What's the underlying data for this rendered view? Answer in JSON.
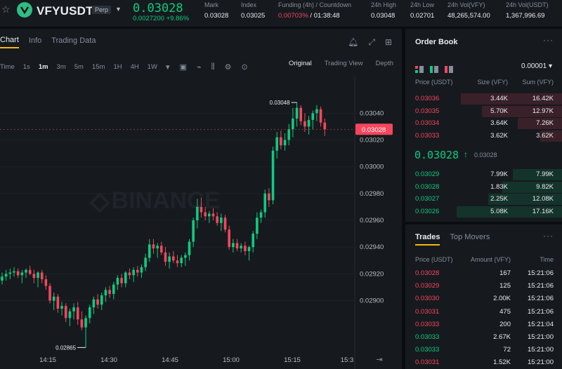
{
  "header": {
    "symbol": "VFYUSDT",
    "badge": "Perp",
    "last_price": "0.03028",
    "change": "0.0027200 +9.86%",
    "stats": [
      {
        "label": "Mark",
        "value": "0.03028"
      },
      {
        "label": "Index",
        "value": "0.03025"
      },
      {
        "label": "Funding (4h) / Countdown",
        "value_red": "0.00703%",
        "value": " / 01:38:48"
      },
      {
        "label": "24h High",
        "value": "0.03048"
      },
      {
        "label": "24h Low",
        "value": "0.02701"
      },
      {
        "label": "24h Vol(VFY)",
        "value": "48,265,574.00"
      },
      {
        "label": "24h Vol(USDT)",
        "value": "1,367,996.69"
      }
    ]
  },
  "chart_tabs": [
    "Chart",
    "Info",
    "Trading Data"
  ],
  "toolbar": {
    "time_label": "Time",
    "timeframes": [
      "1s",
      "1m",
      "3m",
      "5m",
      "15m",
      "1H",
      "4H",
      "1W"
    ],
    "active_timeframe": "1m",
    "views": [
      "Original",
      "Trading View",
      "Depth"
    ],
    "active_view": "Original"
  },
  "colors": {
    "up": "#0ecb81",
    "down": "#f6465d",
    "accent": "#f0b90b",
    "bg": "#0b0e11",
    "panel": "#161a1e"
  },
  "chart_data": {
    "type": "candlestick",
    "watermark": "BINANCE",
    "y_ticks": [
      "0.03040",
      "0.03020",
      "0.03000",
      "0.02980",
      "0.02960",
      "0.02940",
      "0.02920",
      "0.02900"
    ],
    "x_ticks": [
      "14:15",
      "14:30",
      "14:45",
      "15:00",
      "15:15",
      "15:3"
    ],
    "ylim": [
      0.02872,
      0.03058
    ],
    "high_label": "0.03048",
    "low_label": "0.02865",
    "current_price_tag": "0.03028",
    "candles": [
      [
        0.02915,
        0.02921,
        0.02912,
        0.02918
      ],
      [
        0.02918,
        0.02923,
        0.02915,
        0.0292
      ],
      [
        0.0292,
        0.02924,
        0.02916,
        0.02921
      ],
      [
        0.02921,
        0.02925,
        0.02918,
        0.02922
      ],
      [
        0.02922,
        0.02924,
        0.02917,
        0.02919
      ],
      [
        0.02919,
        0.02923,
        0.02913,
        0.02921
      ],
      [
        0.02921,
        0.02924,
        0.02917,
        0.02923
      ],
      [
        0.02923,
        0.02926,
        0.02919,
        0.0292
      ],
      [
        0.0292,
        0.02923,
        0.02913,
        0.02917
      ],
      [
        0.02917,
        0.02922,
        0.0291,
        0.02921
      ],
      [
        0.02921,
        0.02923,
        0.02913,
        0.02916
      ],
      [
        0.02916,
        0.02919,
        0.02908,
        0.02911
      ],
      [
        0.02911,
        0.02913,
        0.02898,
        0.029
      ],
      [
        0.029,
        0.02906,
        0.02893,
        0.02903
      ],
      [
        0.02903,
        0.02905,
        0.02891,
        0.02894
      ],
      [
        0.02894,
        0.02899,
        0.02889,
        0.02896
      ],
      [
        0.02896,
        0.02898,
        0.02884,
        0.02887
      ],
      [
        0.02887,
        0.02894,
        0.02881,
        0.02892
      ],
      [
        0.02892,
        0.02898,
        0.02886,
        0.02895
      ],
      [
        0.02895,
        0.02899,
        0.02882,
        0.02886
      ],
      [
        0.02886,
        0.02892,
        0.02878,
        0.0288
      ],
      [
        0.0288,
        0.02889,
        0.02865,
        0.02887
      ],
      [
        0.02887,
        0.02897,
        0.02883,
        0.02895
      ],
      [
        0.02895,
        0.02903,
        0.0289,
        0.02901
      ],
      [
        0.02901,
        0.02905,
        0.02894,
        0.02897
      ],
      [
        0.02897,
        0.02906,
        0.02893,
        0.02904
      ],
      [
        0.02904,
        0.0291,
        0.02899,
        0.02908
      ],
      [
        0.02908,
        0.02911,
        0.02902,
        0.02905
      ],
      [
        0.02905,
        0.02914,
        0.02901,
        0.02912
      ],
      [
        0.02912,
        0.02919,
        0.02908,
        0.02917
      ],
      [
        0.02917,
        0.0292,
        0.0291,
        0.02913
      ],
      [
        0.02913,
        0.02922,
        0.0291,
        0.02921
      ],
      [
        0.02921,
        0.02924,
        0.02916,
        0.02919
      ],
      [
        0.02919,
        0.02925,
        0.02914,
        0.02923
      ],
      [
        0.02923,
        0.02926,
        0.02918,
        0.02921
      ],
      [
        0.02921,
        0.02927,
        0.02917,
        0.02925
      ],
      [
        0.02925,
        0.02935,
        0.02922,
        0.02932
      ],
      [
        0.02932,
        0.02946,
        0.02929,
        0.02942
      ],
      [
        0.02942,
        0.02946,
        0.02935,
        0.02939
      ],
      [
        0.02939,
        0.02943,
        0.02932,
        0.02941
      ],
      [
        0.02941,
        0.02944,
        0.02934,
        0.02936
      ],
      [
        0.02936,
        0.0294,
        0.02926,
        0.02929
      ],
      [
        0.02929,
        0.02936,
        0.02924,
        0.02933
      ],
      [
        0.02933,
        0.02937,
        0.02928,
        0.0293
      ],
      [
        0.0293,
        0.02934,
        0.02925,
        0.02928
      ],
      [
        0.02928,
        0.02934,
        0.02925,
        0.02932
      ],
      [
        0.02932,
        0.02936,
        0.02926,
        0.02934
      ],
      [
        0.02934,
        0.02946,
        0.0293,
        0.02944
      ],
      [
        0.02944,
        0.02962,
        0.0294,
        0.0296
      ],
      [
        0.0296,
        0.02976,
        0.02954,
        0.0297
      ],
      [
        0.0297,
        0.02977,
        0.02962,
        0.02966
      ],
      [
        0.02966,
        0.0297,
        0.0296,
        0.02963
      ],
      [
        0.02963,
        0.02967,
        0.02958,
        0.02965
      ],
      [
        0.02965,
        0.02969,
        0.0296,
        0.02963
      ],
      [
        0.02963,
        0.02966,
        0.02956,
        0.02958
      ],
      [
        0.02958,
        0.02965,
        0.02952,
        0.02962
      ],
      [
        0.02962,
        0.02964,
        0.02951,
        0.02953
      ],
      [
        0.02953,
        0.02956,
        0.02938,
        0.0294
      ],
      [
        0.0294,
        0.02946,
        0.02936,
        0.02943
      ],
      [
        0.02943,
        0.02946,
        0.02937,
        0.02939
      ],
      [
        0.02939,
        0.02943,
        0.02936,
        0.02941
      ],
      [
        0.02941,
        0.02944,
        0.02934,
        0.02937
      ],
      [
        0.02937,
        0.02941,
        0.0293,
        0.0294
      ],
      [
        0.0294,
        0.02952,
        0.02936,
        0.0295
      ],
      [
        0.0295,
        0.02966,
        0.02946,
        0.02962
      ],
      [
        0.02962,
        0.02968,
        0.02958,
        0.02966
      ],
      [
        0.02966,
        0.02983,
        0.02962,
        0.0298
      ],
      [
        0.0298,
        0.02984,
        0.0297,
        0.02975
      ],
      [
        0.02975,
        0.03015,
        0.02972,
        0.03012
      ],
      [
        0.03012,
        0.03026,
        0.03006,
        0.03022
      ],
      [
        0.03022,
        0.03027,
        0.03013,
        0.03016
      ],
      [
        0.03016,
        0.03025,
        0.03012,
        0.0302
      ],
      [
        0.0302,
        0.03032,
        0.03016,
        0.03028
      ],
      [
        0.03028,
        0.03044,
        0.03022,
        0.03036
      ],
      [
        0.03036,
        0.03048,
        0.0303,
        0.03044
      ],
      [
        0.03044,
        0.03046,
        0.03031,
        0.03034
      ],
      [
        0.03034,
        0.0304,
        0.03026,
        0.0303
      ],
      [
        0.0303,
        0.03038,
        0.03024,
        0.03035
      ],
      [
        0.03035,
        0.03042,
        0.03028,
        0.0304
      ],
      [
        0.0304,
        0.03046,
        0.03034,
        0.03043
      ],
      [
        0.03043,
        0.03045,
        0.0303,
        0.03033
      ],
      [
        0.03033,
        0.03036,
        0.03023,
        0.03028
      ]
    ]
  },
  "order_book": {
    "title": "Order Book",
    "tick_size": "0.00001",
    "headers": [
      "Price (USDT)",
      "Size (VFY)",
      "Sum (VFY)"
    ],
    "asks": [
      {
        "price": "0.03036",
        "size": "3.44K",
        "sum": "16.42K",
        "depth": 0.96
      },
      {
        "price": "0.03035",
        "size": "5.70K",
        "sum": "12.97K",
        "depth": 0.76
      },
      {
        "price": "0.03034",
        "size": "3.64K",
        "sum": "7.26K",
        "depth": 0.42
      },
      {
        "price": "0.03033",
        "size": "3.62K",
        "sum": "3.62K",
        "depth": 0.21
      }
    ],
    "mid_price": "0.03028",
    "mid_mark": "0.03028",
    "bids": [
      {
        "price": "0.03029",
        "size": "7.99K",
        "sum": "7.99K",
        "depth": 0.47
      },
      {
        "price": "0.03028",
        "size": "1.83K",
        "sum": "9.82K",
        "depth": 0.57
      },
      {
        "price": "0.03027",
        "size": "2.25K",
        "sum": "12.08K",
        "depth": 0.7
      },
      {
        "price": "0.03026",
        "size": "5.08K",
        "sum": "17.16K",
        "depth": 1.0
      }
    ]
  },
  "trades": {
    "tabs": [
      "Trades",
      "Top Movers"
    ],
    "headers": [
      "Price (USDT)",
      "Amount (VFY)",
      "Time"
    ],
    "rows": [
      {
        "price": "0.03028",
        "amount": "167",
        "time": "15:21:06",
        "side": "sell"
      },
      {
        "price": "0.03029",
        "amount": "125",
        "time": "15:21:06",
        "side": "sell"
      },
      {
        "price": "0.03030",
        "amount": "2.00K",
        "time": "15:21:06",
        "side": "sell"
      },
      {
        "price": "0.03031",
        "amount": "475",
        "time": "15:21:06",
        "side": "sell"
      },
      {
        "price": "0.03033",
        "amount": "200",
        "time": "15:21:04",
        "side": "sell"
      },
      {
        "price": "0.03033",
        "amount": "2.67K",
        "time": "15:21:00",
        "side": "buy"
      },
      {
        "price": "0.03033",
        "amount": "72",
        "time": "15:21:00",
        "side": "buy"
      },
      {
        "price": "0.03031",
        "amount": "1.52K",
        "time": "15:21:00",
        "side": "sell"
      }
    ]
  }
}
